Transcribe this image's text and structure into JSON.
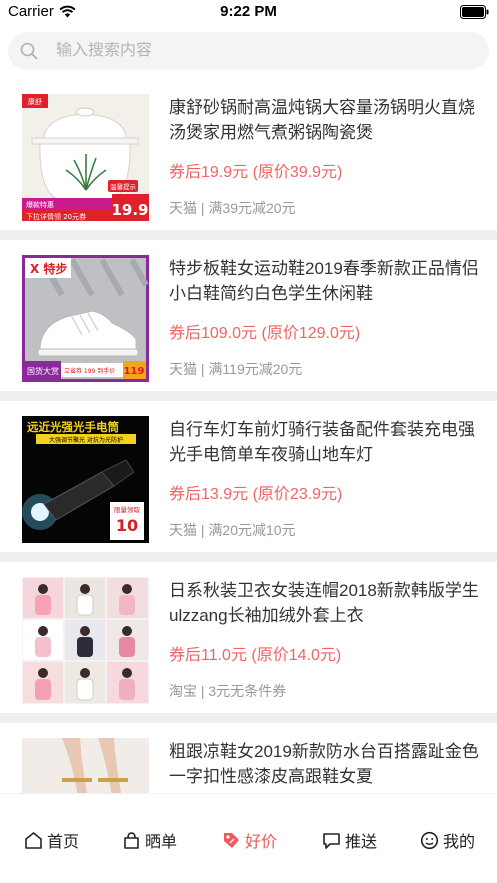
{
  "status": {
    "carrier": "Carrier",
    "time": "9:22 PM"
  },
  "search": {
    "placeholder": "输入搜索内容"
  },
  "items": [
    {
      "title": "康舒砂锅耐高温炖锅大容量汤锅明火直烧汤煲家用燃气煮粥锅陶瓷煲",
      "price": "券后19.9元 (原价39.9元)",
      "meta": "天猫 | 满39元减20元",
      "thumb": {
        "brand": "康舒",
        "tag": "温馨提示",
        "promo": "爆款特惠",
        "coupon": "下拉详情领 20元券",
        "price_mark": "19.9"
      }
    },
    {
      "title": "特步板鞋女运动鞋2019春季新款正品情侣小白鞋简约白色学生休闲鞋",
      "price": "券后109.0元 (原价129.0元)",
      "meta": "天猫 | 满119元减20元",
      "thumb": {
        "brand": "X 特步",
        "promo": "国货大赏",
        "coupon": "立省券 199 到手价",
        "price_mark": "119"
      }
    },
    {
      "title": "自行车灯车前灯骑行装备配件套装充电强光手电筒单车夜骑山地车灯",
      "price": "券后13.9元 (原价23.9元)",
      "meta": "天猫 | 满20元减10元",
      "thumb": {
        "headline": "远近光强光手电筒",
        "sub": "大强调节聚光 对抗为光防护",
        "tag": "限量领取",
        "coupon_value": "10"
      }
    },
    {
      "title": "日系秋装卫衣女装连帽2018新款韩版学生ulzzang长袖加绒外套上衣",
      "price": "券后11.0元 (原价14.0元)",
      "meta": "淘宝 | 3元无条件券"
    },
    {
      "title": "粗跟凉鞋女2019新款防水台百搭露趾金色一字扣性感漆皮高跟鞋女夏",
      "price": "",
      "meta": ""
    }
  ],
  "tabs": [
    {
      "label": "首页",
      "icon": "home-icon"
    },
    {
      "label": "晒单",
      "icon": "bag-icon"
    },
    {
      "label": "好价",
      "icon": "tag-icon"
    },
    {
      "label": "推送",
      "icon": "chat-icon"
    },
    {
      "label": "我的",
      "icon": "smile-icon"
    }
  ],
  "active_tab": "好价",
  "colors": {
    "accent": "#f05a5a",
    "price": "#f06464",
    "meta": "#999999",
    "separator": "#efefef"
  }
}
